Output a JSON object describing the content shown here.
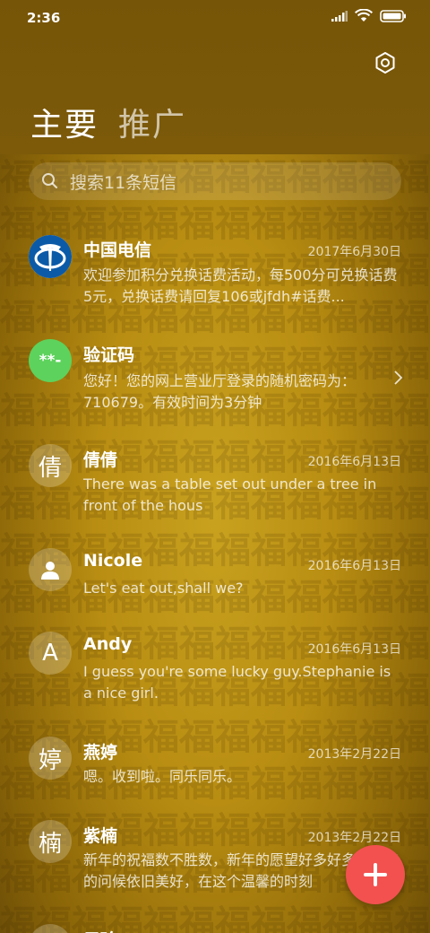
{
  "status_bar": {
    "time": "2:36"
  },
  "tabs": [
    {
      "label": "主要"
    },
    {
      "label": "推广"
    }
  ],
  "search": {
    "placeholder": "搜索11条短信"
  },
  "background_pattern": "福",
  "conversations": [
    {
      "name": "中国电信",
      "date": "2017年6月30日",
      "preview": "欢迎参加积分兑换话费活动，每500分可兑换话费5元，兑换话费请回复106或jfdh#话费...",
      "avatar": "china-telecom-logo"
    },
    {
      "name": "验证码",
      "date": "",
      "preview": "您好！您的网上营业厅登录的随机密码为：710679。有效时间为3分钟",
      "avatar_text": "**-"
    },
    {
      "name": "倩倩",
      "date": "2016年6月13日",
      "preview": "There was a table set out under a tree in front of the hous",
      "avatar_text": "倩"
    },
    {
      "name": "Nicole",
      "date": "2016年6月13日",
      "preview": "Let's eat out,shall we?",
      "avatar": "person-icon"
    },
    {
      "name": "Andy",
      "date": "2016年6月13日",
      "preview": "I guess you're some lucky guy.Stephanie is a nice girl.",
      "avatar_text": "A"
    },
    {
      "name": "燕婷",
      "date": "2013年2月22日",
      "preview": "嗯。收到啦。同乐同乐。",
      "avatar_text": "婷"
    },
    {
      "name": "紫楠",
      "date": "2013年2月22日",
      "preview": "新年的祝福数不胜数，新年的愿望好多好多，新年的问候依旧美好，在这个温馨的时刻",
      "avatar_text": "楠"
    },
    {
      "name": "子玲",
      "date": "",
      "preview": "",
      "avatar_text": ""
    }
  ],
  "colors": {
    "accent": "#f25150",
    "verify_avatar": "#5dd25c",
    "telecom_blue": "#0b5aa8"
  }
}
